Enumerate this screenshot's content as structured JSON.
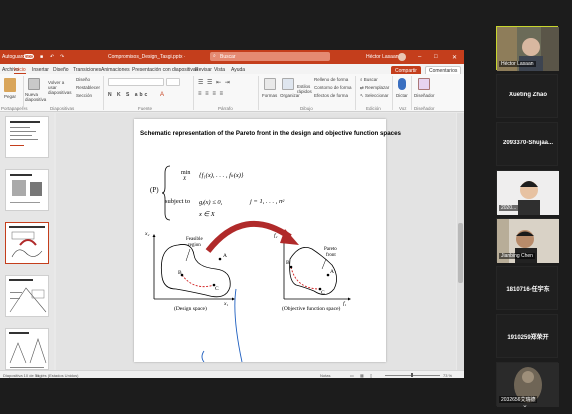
{
  "titlebar": {
    "autosave_label": "Autoguardado",
    "file_name": "Compromisos_Design_Tasgi.pptx  ·",
    "search_placeholder": "Buscar",
    "user_name": "Héctor Lasaan"
  },
  "tabs": [
    "Archivo",
    "Inicio",
    "Insertar",
    "Diseño",
    "Transiciones",
    "Animaciones",
    "Presentación con diapositivas",
    "Revisar",
    "Vista",
    "Ayuda"
  ],
  "active_tab": "Inicio",
  "share_label": "Compartir",
  "comments_label": "Comentarios",
  "ribbon": {
    "paste_label": "Pegar",
    "new_slide_label": "Nueva diapositiva",
    "reuse_label": "Volver a usar diapositivas",
    "layout_label": "Diseño",
    "reset_label": "Restablecer",
    "section_label": "Sección",
    "group_clipboard": "Portapapeles",
    "group_slides": "Diapositivas",
    "group_font": "Fuente",
    "group_paragraph": "Párrafo",
    "group_drawing": "Dibujo",
    "group_editing": "Edición",
    "group_voice": "Voz",
    "group_designer": "Diseñador",
    "shapes_label": "Formas",
    "arrange_label": "Organizar",
    "quick_styles_label": "Estilos rápidos",
    "shape_fill": "Relleno de forma",
    "shape_outline": "Contorno de forma",
    "shape_effects": "Efectos de forma",
    "find_label": "Buscar",
    "replace_label": "Reemplazar",
    "select_label": "Seleccionar",
    "dictate_label": "Dictar",
    "designer_label": "Diseñador"
  },
  "slide": {
    "title": "Schematic representation of the Pareto front in the design  and objective function spaces",
    "problem_label": "(P)",
    "min_label": "min",
    "min_sub": "X",
    "objective": "{f₁(x), . . . , fₖ(x)}",
    "subject_to": "subject to",
    "constraint1": "gⱼ(x) ≤ 0,",
    "constraint_range": "j = 1, . . . , nᵍ",
    "constraint2": "x ∈ X",
    "design_axis_y": "x₂",
    "design_axis_x": "x₁",
    "feasible_label_1": "Feasible",
    "feasible_label_2": "region",
    "point_a": "A",
    "point_b": "B",
    "point_c": "C",
    "design_caption": "(Design space)",
    "objective_axis_y": "f₂",
    "objective_axis_x": "f₁",
    "pareto_label_1": "Pareto",
    "pareto_label_2": "front",
    "objective_caption": "(Objective function space)"
  },
  "status": {
    "slide_counter": "Diapositiva 10 de 51",
    "language": "Inglés (Estados Unidos)",
    "notes_label": "Notas",
    "zoom_text": "73 %"
  },
  "participants": [
    {
      "name": "Héctor Lasaan",
      "type": "video"
    },
    {
      "name": "Xueting Zhao",
      "type": "name"
    },
    {
      "name": "2093370-Shujaa...",
      "type": "name"
    },
    {
      "name": "2020...",
      "type": "video"
    },
    {
      "name": "Jianbing Chen",
      "type": "video"
    },
    {
      "name": "1810716-任宇东",
      "type": "name"
    },
    {
      "name": "1910259郑荣开",
      "type": "name"
    },
    {
      "name": "2032656艾瑞德",
      "type": "video"
    }
  ],
  "colors": {
    "ppt_accent": "#c43e1c",
    "active_speaker": "#c8d62e",
    "arrow_red": "#b02a2a",
    "pen_blue": "#2060c0",
    "pareto_dash": "#d22020"
  }
}
